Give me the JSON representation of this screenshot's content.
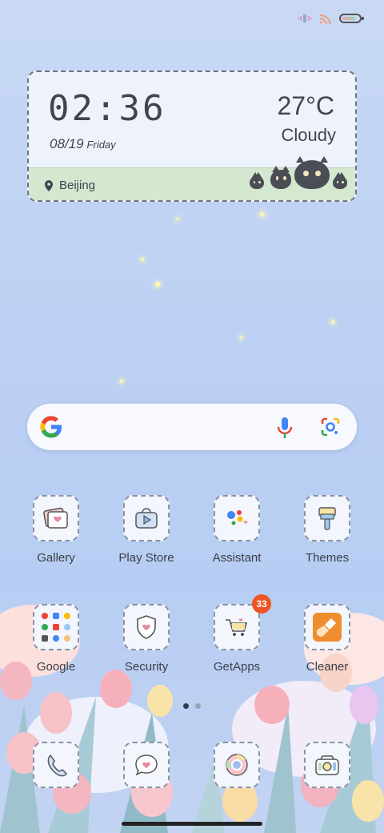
{
  "status": {
    "icons": [
      "vibration-icon",
      "wifi-icon",
      "battery-icon"
    ]
  },
  "widget": {
    "time": "02:36",
    "date": "08/19",
    "day": "Friday",
    "temperature": "27°C",
    "condition": "Cloudy",
    "location": "Beijing"
  },
  "search": {
    "icons": [
      "google-logo-icon",
      "microphone-icon",
      "google-lens-icon"
    ]
  },
  "apps_row1": [
    {
      "label": "Gallery",
      "icon": "gallery-icon"
    },
    {
      "label": "Play Store",
      "icon": "play-store-icon"
    },
    {
      "label": "Assistant",
      "icon": "assistant-icon"
    },
    {
      "label": "Themes",
      "icon": "themes-icon"
    }
  ],
  "apps_row2": [
    {
      "label": "Google",
      "icon": "google-folder-icon"
    },
    {
      "label": "Security",
      "icon": "security-icon"
    },
    {
      "label": "GetApps",
      "icon": "getapps-icon",
      "badge": "33"
    },
    {
      "label": "Cleaner",
      "icon": "cleaner-icon"
    }
  ],
  "dock": [
    {
      "icon": "phone-icon"
    },
    {
      "icon": "messages-icon"
    },
    {
      "icon": "chrome-icon"
    },
    {
      "icon": "camera-icon"
    }
  ],
  "pagination": {
    "pages": 2,
    "active": 1
  },
  "colors": {
    "badge": "#ee5523",
    "accent_orange": "#f08d2e"
  }
}
